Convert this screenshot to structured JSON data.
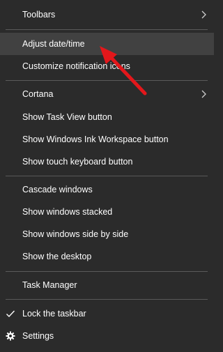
{
  "menu": {
    "items": [
      {
        "label": "Toolbars",
        "has_submenu": true
      },
      {
        "label": "Adjust date/time",
        "highlighted": true
      },
      {
        "label": "Customize notification icons"
      },
      {
        "label": "Cortana",
        "has_submenu": true
      },
      {
        "label": "Show Task View button"
      },
      {
        "label": "Show Windows Ink Workspace button"
      },
      {
        "label": "Show touch keyboard button"
      },
      {
        "label": "Cascade windows"
      },
      {
        "label": "Show windows stacked"
      },
      {
        "label": "Show windows side by side"
      },
      {
        "label": "Show the desktop"
      },
      {
        "label": "Task Manager"
      },
      {
        "label": "Lock the taskbar",
        "checked": true,
        "icon": "check-icon"
      },
      {
        "label": "Settings",
        "icon": "gear-icon"
      }
    ]
  },
  "colors": {
    "background": "#2b2b2b",
    "highlight": "#414141",
    "separator": "#5a5a5a",
    "text": "#ffffff",
    "annotation_arrow": "#e3171b"
  }
}
